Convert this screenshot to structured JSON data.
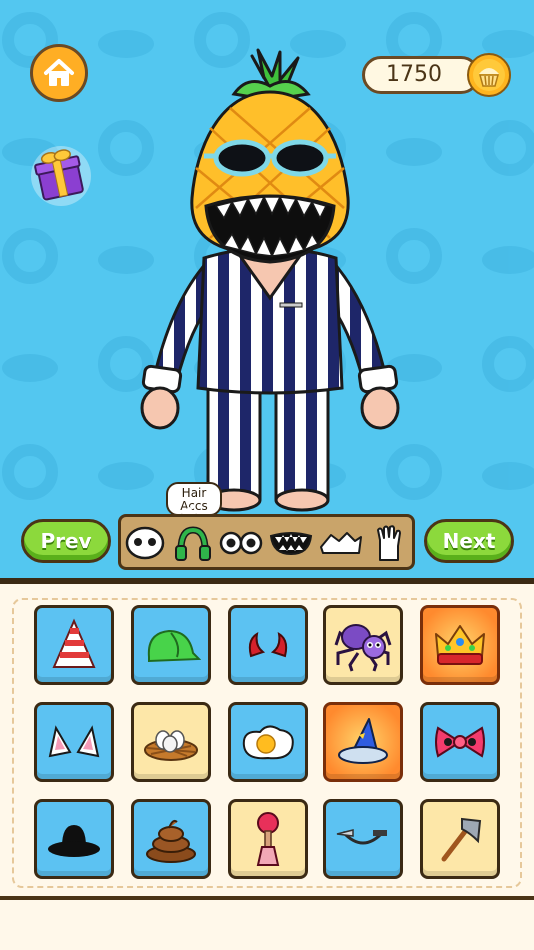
{
  "hud": {
    "coins": "1750",
    "home_icon": "home-icon",
    "coin_icon": "cupcake-coin-icon",
    "gift_icon": "gift-box-icon"
  },
  "character": {
    "head": "pineapple",
    "eyewear": "teal goggles",
    "mouth": "big toothy grin",
    "outfit": "navy striped pajamas"
  },
  "nav": {
    "prev_label": "Prev",
    "next_label": "Next"
  },
  "category_tooltip": {
    "line1": "Hair",
    "line2": "Accs"
  },
  "categories": [
    {
      "icon": "face-icon"
    },
    {
      "icon": "headphones-icon",
      "selected": true
    },
    {
      "icon": "eyes-icon"
    },
    {
      "icon": "mouth-icon"
    },
    {
      "icon": "shoes-icon"
    },
    {
      "icon": "glove-icon"
    }
  ],
  "items": [
    {
      "icon": "party-hat-icon",
      "bg": "blue"
    },
    {
      "icon": "green-cap-icon",
      "bg": "blue"
    },
    {
      "icon": "devil-horns-icon",
      "bg": "blue"
    },
    {
      "icon": "spider-icon",
      "bg": "gold"
    },
    {
      "icon": "crown-icon",
      "bg": "orange"
    },
    {
      "icon": "cat-ears-icon",
      "bg": "blue"
    },
    {
      "icon": "bird-nest-icon",
      "bg": "gold"
    },
    {
      "icon": "fried-egg-icon",
      "bg": "blue"
    },
    {
      "icon": "wizard-hat-icon",
      "bg": "orange"
    },
    {
      "icon": "pink-bow-icon",
      "bg": "blue"
    },
    {
      "icon": "black-hat-icon",
      "bg": "blue"
    },
    {
      "icon": "poop-icon",
      "bg": "blue"
    },
    {
      "icon": "plunger-icon",
      "bg": "gold"
    },
    {
      "icon": "knife-headband-icon",
      "bg": "blue"
    },
    {
      "icon": "axe-icon",
      "bg": "gold"
    }
  ],
  "colors": {
    "sky": "#53c7f0",
    "panel": "#fff8ea",
    "green_button": "#8cd93c",
    "orange_button": "#ffae24"
  }
}
